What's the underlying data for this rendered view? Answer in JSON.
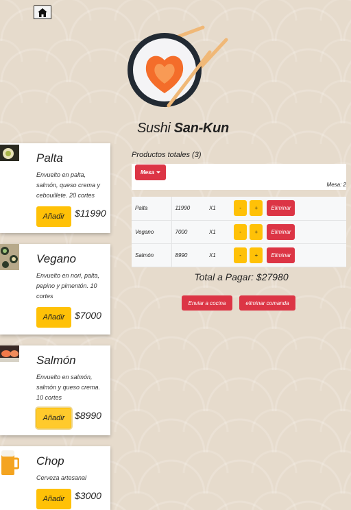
{
  "brand": {
    "name_light": "Sushi",
    "name_bold": "San-Kun"
  },
  "nav": {
    "home_icon": "home-icon"
  },
  "products": [
    {
      "name": "Palta",
      "description": "Envuelto en palta, salmón, queso crema y cebouillete. 20 cortes",
      "add_label": "Añadir",
      "price": "$11990"
    },
    {
      "name": "Vegano",
      "description": "Envuelto en nori, palta, pepino y pimentón. 10 cortes",
      "add_label": "Añadir",
      "price": "$7000"
    },
    {
      "name": "Salmón",
      "description": "Envuelto en salmón, salmón y queso crema. 10 cortes",
      "add_label": "Añadir",
      "price": "$8990"
    },
    {
      "name": "Chop",
      "description": "Cerveza artesanal",
      "add_label": "Añadir",
      "price": "$3000"
    }
  ],
  "order": {
    "total_products_label": "Productos totales (3)",
    "mesa_button": "Mesa",
    "mesa_label": "Mesa: 2",
    "rows": [
      {
        "name": "Palta",
        "price": "11990",
        "qty": "X1",
        "minus": "-",
        "plus": "+",
        "delete": "Eliminar"
      },
      {
        "name": "Vegano",
        "price": "7000",
        "qty": "X1",
        "minus": "-",
        "plus": "+",
        "delete": "Eliminar"
      },
      {
        "name": "Salmón",
        "price": "8990",
        "qty": "X1",
        "minus": "-",
        "plus": "+",
        "delete": "Eliminar"
      }
    ],
    "total_label": "Total a Pagar: $27980",
    "send_button": "Enviar a cocina",
    "delete_order_button": "eliminar comanda"
  },
  "colors": {
    "accent_red": "#dc3545",
    "accent_yellow": "#ffc107",
    "background": "#e6dbcc"
  }
}
